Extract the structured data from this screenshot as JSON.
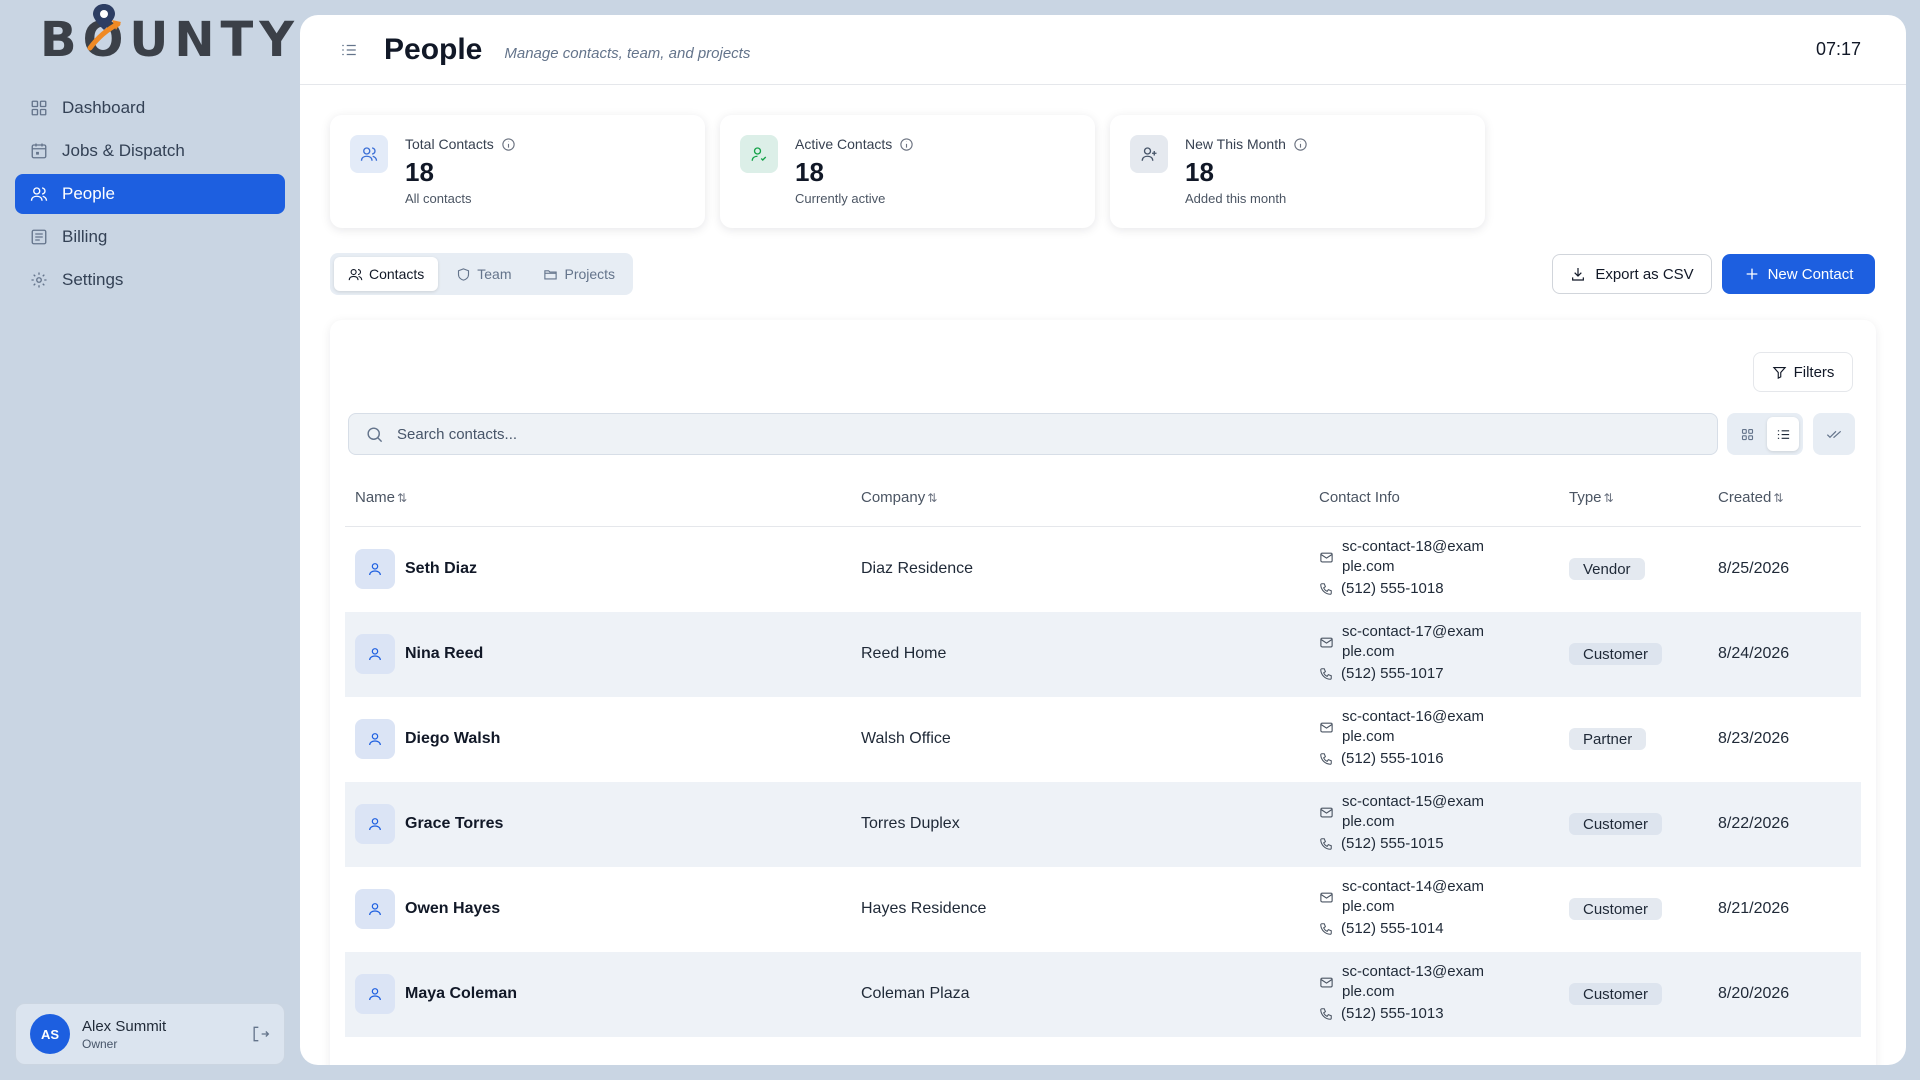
{
  "app": {
    "logo_text": "BOUNTY",
    "brand_color": "#1d5fe0",
    "accent_color": "#f08a24"
  },
  "sidebar": {
    "items": [
      {
        "label": "Dashboard",
        "icon": "grid-icon"
      },
      {
        "label": "Jobs & Dispatch",
        "icon": "calendar-icon"
      },
      {
        "label": "People",
        "icon": "users-icon",
        "active": true
      },
      {
        "label": "Billing",
        "icon": "receipt-icon"
      },
      {
        "label": "Settings",
        "icon": "gear-icon"
      }
    ],
    "user": {
      "initials": "AS",
      "name": "Alex Summit",
      "role": "Owner"
    }
  },
  "header": {
    "title": "People",
    "subtitle": "Manage contacts, team, and projects",
    "time": "07:17"
  },
  "stats": [
    {
      "label": "Total Contacts",
      "value": "18",
      "sub": "All contacts",
      "icon": "users-icon",
      "icon_color": "#3b6fd6",
      "icon_bg": "#e3ebf8"
    },
    {
      "label": "Active Contacts",
      "value": "18",
      "sub": "Currently active",
      "icon": "user-check-icon",
      "icon_color": "#16a34a",
      "icon_bg": "#dcefe8"
    },
    {
      "label": "New This Month",
      "value": "18",
      "sub": "Added this month",
      "icon": "user-plus-icon",
      "icon_color": "#475569",
      "icon_bg": "#e5e9ef"
    }
  ],
  "tabs": [
    {
      "label": "Contacts",
      "icon": "users-icon",
      "active": true
    },
    {
      "label": "Team",
      "icon": "shield-icon"
    },
    {
      "label": "Projects",
      "icon": "folder-icon"
    }
  ],
  "actions": {
    "export_label": "Export as CSV",
    "new_label": "New Contact"
  },
  "toolbar": {
    "filters_label": "Filters",
    "search_placeholder": "Search contacts..."
  },
  "table": {
    "columns": [
      {
        "label": "Name",
        "sortable": true
      },
      {
        "label": "Company",
        "sortable": true
      },
      {
        "label": "Contact Info",
        "sortable": false
      },
      {
        "label": "Type",
        "sortable": true
      },
      {
        "label": "Created",
        "sortable": true
      }
    ],
    "rows": [
      {
        "name": "Seth Diaz",
        "company": "Diaz Residence",
        "email": "sc-contact-18@example.com",
        "phone": "(512) 555-1018",
        "type": "Vendor",
        "created": "8/25/2026"
      },
      {
        "name": "Nina Reed",
        "company": "Reed Home",
        "email": "sc-contact-17@example.com",
        "phone": "(512) 555-1017",
        "type": "Customer",
        "created": "8/24/2026"
      },
      {
        "name": "Diego Walsh",
        "company": "Walsh Office",
        "email": "sc-contact-16@example.com",
        "phone": "(512) 555-1016",
        "type": "Partner",
        "created": "8/23/2026"
      },
      {
        "name": "Grace Torres",
        "company": "Torres Duplex",
        "email": "sc-contact-15@example.com",
        "phone": "(512) 555-1015",
        "type": "Customer",
        "created": "8/22/2026"
      },
      {
        "name": "Owen Hayes",
        "company": "Hayes Residence",
        "email": "sc-contact-14@example.com",
        "phone": "(512) 555-1014",
        "type": "Customer",
        "created": "8/21/2026"
      },
      {
        "name": "Maya Coleman",
        "company": "Coleman Plaza",
        "email": "sc-contact-13@example.com",
        "phone": "(512) 555-1013",
        "type": "Customer",
        "created": "8/20/2026"
      }
    ]
  }
}
